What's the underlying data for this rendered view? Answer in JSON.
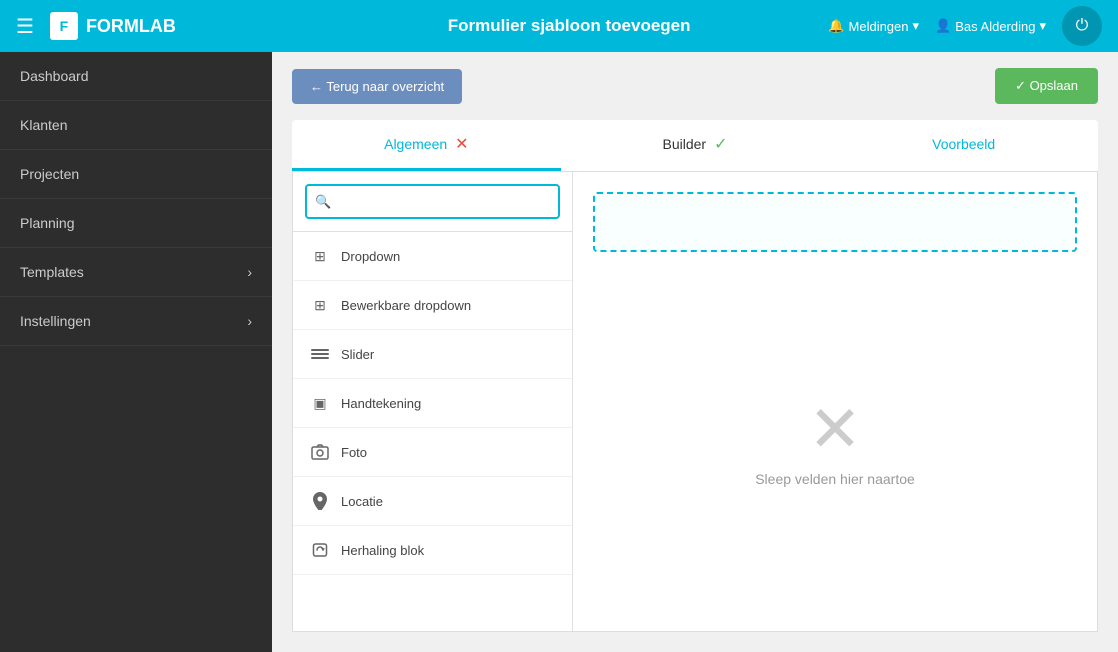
{
  "header": {
    "logo_text": "FORMLAB",
    "logo_icon": "F",
    "title": "Formulier sjabloon toevoegen",
    "hamburger": "☰",
    "notifications_label": "Meldingen",
    "user_label": "Bas Alderding",
    "power_icon": "⏻",
    "bell_icon": "🔔",
    "user_icon": "👤",
    "caret": "▾"
  },
  "sidebar": {
    "items": [
      {
        "id": "dashboard",
        "label": "Dashboard",
        "has_chevron": false
      },
      {
        "id": "klanten",
        "label": "Klanten",
        "has_chevron": false
      },
      {
        "id": "projecten",
        "label": "Projecten",
        "has_chevron": false
      },
      {
        "id": "planning",
        "label": "Planning",
        "has_chevron": false
      },
      {
        "id": "templates",
        "label": "Templates",
        "has_chevron": true
      },
      {
        "id": "instellingen",
        "label": "Instellingen",
        "has_chevron": true
      }
    ]
  },
  "action_bar": {
    "back_btn_label": "← Terug naar overzicht",
    "save_btn_label": "✓ Opslaan"
  },
  "tabs": [
    {
      "id": "algemeen",
      "label": "Algemeen",
      "badge": "✕",
      "badge_type": "red",
      "active": true
    },
    {
      "id": "builder",
      "label": "Builder",
      "badge": "✓",
      "badge_type": "green",
      "active": false
    },
    {
      "id": "voorbeeld",
      "label": "Voorbeeld",
      "badge": "",
      "badge_type": "",
      "active": false
    }
  ],
  "search": {
    "placeholder": "",
    "icon": "🔍"
  },
  "fields": [
    {
      "id": "dropdown",
      "label": "Dropdown",
      "icon": "⊞"
    },
    {
      "id": "bewerkbare-dropdown",
      "label": "Bewerkbare dropdown",
      "icon": "⊞"
    },
    {
      "id": "slider",
      "label": "Slider",
      "icon": "≡"
    },
    {
      "id": "handtekening",
      "label": "Handtekening",
      "icon": "▣"
    },
    {
      "id": "foto",
      "label": "Foto",
      "icon": "📷"
    },
    {
      "id": "locatie",
      "label": "Locatie",
      "icon": "📍"
    },
    {
      "id": "herhaling-blok",
      "label": "Herhaling blok",
      "icon": "↻"
    }
  ],
  "drop_zone": {
    "placeholder_icon": "✕",
    "placeholder_text": "Sleep velden hier naartoe"
  }
}
